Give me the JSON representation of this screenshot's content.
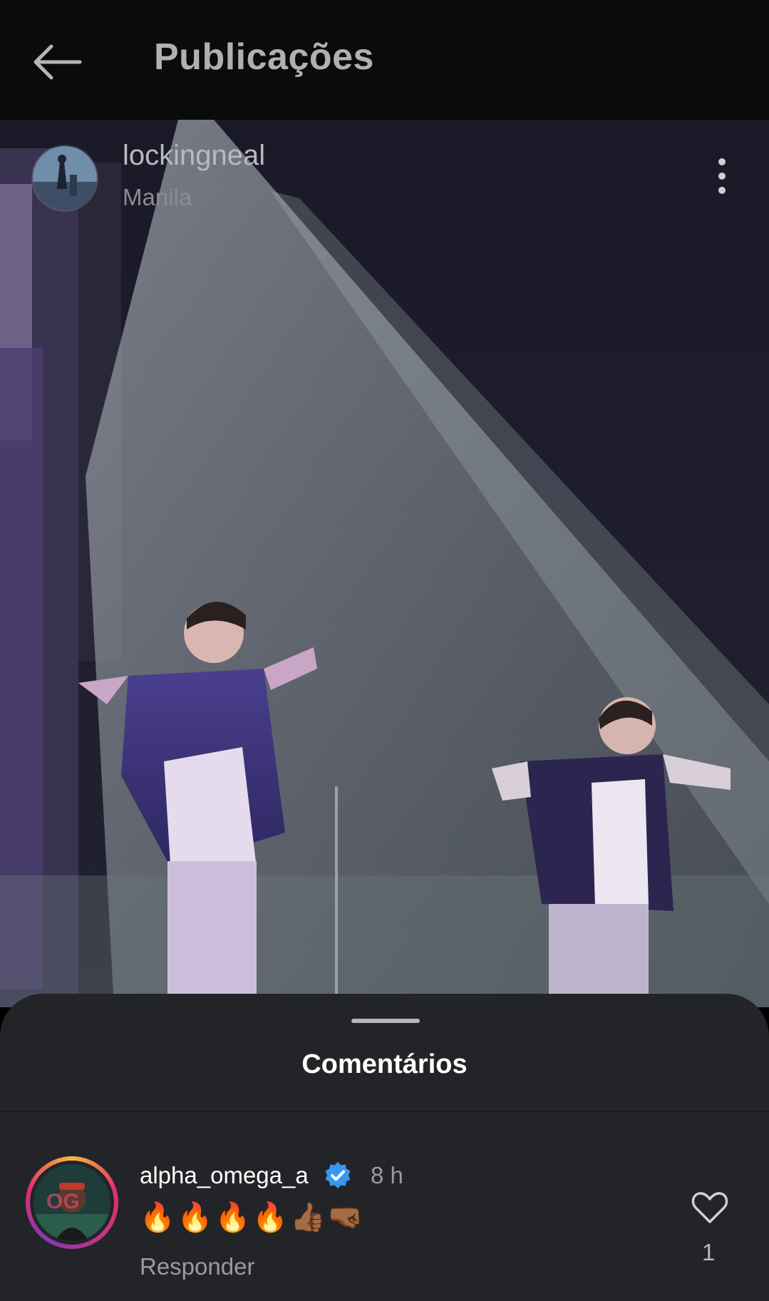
{
  "header": {
    "title": "Publicações",
    "back_icon": "arrow-left-icon"
  },
  "post": {
    "username": "lockingneal",
    "location": "Manila",
    "more_icon": "more-vertical-icon"
  },
  "comments_sheet": {
    "title": "Comentários",
    "comments": [
      {
        "username": "alpha_omega_a",
        "verified": true,
        "time": "8 h",
        "text": "🔥🔥🔥🔥👍🏾🤜🏾",
        "reply_label": "Responder",
        "like_count": "1"
      }
    ]
  },
  "colors": {
    "background": "#000000",
    "header_bg": "#0b0b0c",
    "sheet_bg": "#232427",
    "verified_blue": "#3897f0",
    "muted_text": "#9a9aa0"
  }
}
